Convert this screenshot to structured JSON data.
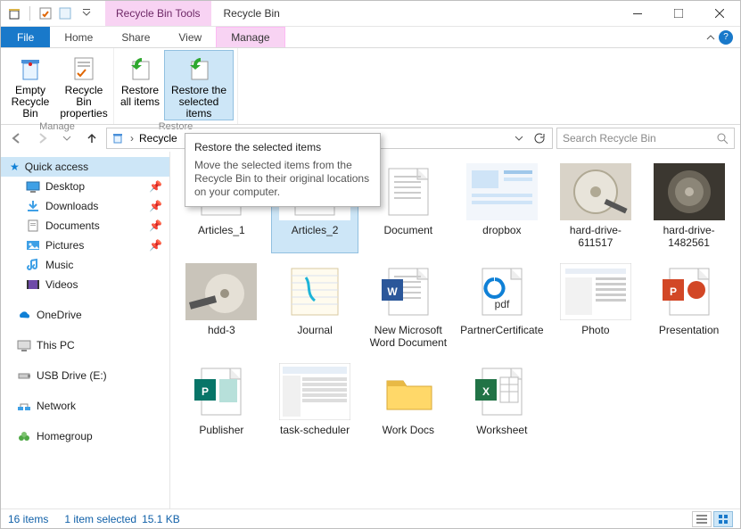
{
  "window": {
    "contextual_tab": "Recycle Bin Tools",
    "title": "Recycle Bin"
  },
  "tabs": {
    "file": "File",
    "home": "Home",
    "share": "Share",
    "view": "View",
    "manage": "Manage"
  },
  "ribbon": {
    "empty": "Empty Recycle Bin",
    "props": "Recycle Bin properties",
    "group_manage": "Manage",
    "restore_all": "Restore all items",
    "restore_sel": "Restore the selected items",
    "group_restore": "Restore"
  },
  "breadcrumb": {
    "location": "Recycle"
  },
  "search": {
    "placeholder": "Search Recycle Bin"
  },
  "tooltip": {
    "title": "Restore the selected items",
    "body": "Move the selected items from the Recycle Bin to their original locations on your computer."
  },
  "nav": {
    "quick": "Quick access",
    "desktop": "Desktop",
    "downloads": "Downloads",
    "documents": "Documents",
    "pictures": "Pictures",
    "music": "Music",
    "videos": "Videos",
    "onedrive": "OneDrive",
    "thispc": "This PC",
    "usb": "USB Drive (E:)",
    "network": "Network",
    "homegroup": "Homegroup"
  },
  "items": [
    {
      "label": "Articles_1",
      "kind": "word"
    },
    {
      "label": "Articles_2",
      "kind": "word",
      "selected": true
    },
    {
      "label": "Document",
      "kind": "txt"
    },
    {
      "label": "dropbox",
      "kind": "img-dropbox"
    },
    {
      "label": "hard-drive-611517",
      "kind": "img-hdd"
    },
    {
      "label": "hard-drive-1482561",
      "kind": "img-hdd2"
    },
    {
      "label": "hdd-3",
      "kind": "img-hdd3"
    },
    {
      "label": "Journal",
      "kind": "journal"
    },
    {
      "label": "New Microsoft Word Document",
      "kind": "word"
    },
    {
      "label": "PartnerCertificate",
      "kind": "pdf"
    },
    {
      "label": "Photo",
      "kind": "img-settings"
    },
    {
      "label": "Presentation",
      "kind": "ppt"
    },
    {
      "label": "Publisher",
      "kind": "pub"
    },
    {
      "label": "task-scheduler",
      "kind": "img-app"
    },
    {
      "label": "Work Docs",
      "kind": "folder"
    },
    {
      "label": "Worksheet",
      "kind": "xls"
    }
  ],
  "status": {
    "count": "16 items",
    "selected": "1 item selected",
    "size": "15.1 KB"
  }
}
